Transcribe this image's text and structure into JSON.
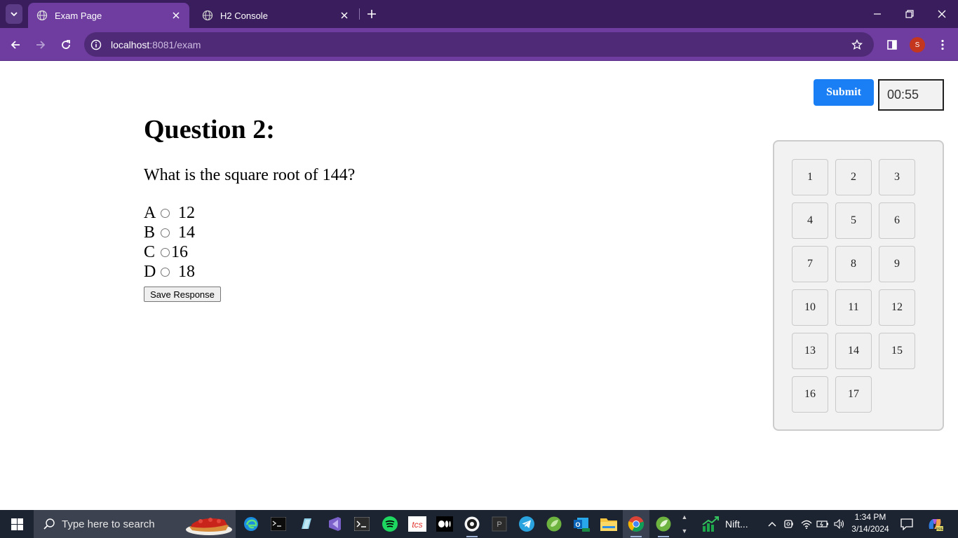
{
  "browser": {
    "tabs": [
      {
        "title": "Exam Page",
        "active": true
      },
      {
        "title": "H2 Console",
        "active": false
      }
    ],
    "url_host": "localhost",
    "url_path": ":8081/exam",
    "profile_initial": "S"
  },
  "exam": {
    "submit_label": "Submit",
    "timer": "00:55",
    "question_title": "Question 2:",
    "question_text": "What is the square root of 144?",
    "options": [
      {
        "letter": "A",
        "value": " 12"
      },
      {
        "letter": "B",
        "value": " 14"
      },
      {
        "letter": "C",
        "value": "16"
      },
      {
        "letter": "D",
        "value": " 18"
      }
    ],
    "save_label": "Save Response",
    "palette": [
      "1",
      "2",
      "3",
      "4",
      "5",
      "6",
      "7",
      "8",
      "9",
      "10",
      "11",
      "12",
      "13",
      "14",
      "15",
      "16",
      "17"
    ]
  },
  "taskbar": {
    "search_placeholder": "Type here to search",
    "nifty_label": "Nift...",
    "time": "1:34 PM",
    "date": "3/14/2024"
  },
  "colors": {
    "chrome_dark": "#3a1d5c",
    "chrome_toolbar": "#6e3d9f",
    "submit_blue": "#1a7ff5",
    "taskbar": "#1c2331"
  }
}
